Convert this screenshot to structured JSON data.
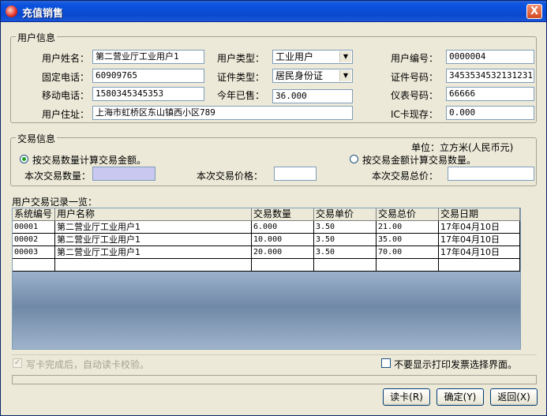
{
  "window": {
    "title": "充值销售",
    "close_label": "X"
  },
  "user_info": {
    "legend": "用户信息",
    "name_label": "用户姓名：",
    "name_value": "第二营业厅工业用户1",
    "type_label": "用户类型：",
    "type_value": "工业用户",
    "number_label": "用户编号：",
    "number_value": "0000004",
    "phone_label": "固定电话：",
    "phone_value": "60909765",
    "id_type_label": "证件类型：",
    "id_type_value": "居民身份证",
    "id_number_label": "证件号码：",
    "id_number_value": "3453534532131231",
    "mobile_label": "移动电话：",
    "mobile_value": "1580345345353",
    "purchased_label": "今年已售：",
    "purchased_value": "36.000",
    "meter_label": "仪表号码：",
    "meter_value": "66666",
    "address_label": "用户住址：",
    "address_value": "上海市虹桥区东山镇西小区789",
    "ic_stock_label": "IC卡现存：",
    "ic_stock_value": "0.000"
  },
  "trade_info": {
    "legend": "交易信息",
    "unit_label": "单位：立方米(人民币元)",
    "radio_by_quantity": "按交易数量计算交易金额。",
    "radio_by_amount": "按交易金额计算交易数量。",
    "quantity_label": "本次交易数量：",
    "quantity_value": "",
    "price_label": "本次交易价格：",
    "price_value": "",
    "total_label": "本次交易总价：",
    "total_value": ""
  },
  "records": {
    "title": "用户交易记录一览：",
    "columns": [
      "系统编号",
      "用户名称",
      "交易数量",
      "交易单价",
      "交易总价",
      "交易日期"
    ],
    "rows": [
      [
        "00001",
        "第二营业厅工业用户1",
        "6.000",
        "3.50",
        "21.00",
        "17年04月10日"
      ],
      [
        "00002",
        "第二营业厅工业用户1",
        "10.000",
        "3.50",
        "35.00",
        "17年04月10日"
      ],
      [
        "00003",
        "第二营业厅工业用户1",
        "20.000",
        "3.50",
        "70.00",
        "17年04月10日"
      ],
      [
        "",
        "",
        "",
        "",
        "",
        ""
      ]
    ]
  },
  "options": {
    "auto_verify_label": "写卡完成后，自动读卡校验。",
    "hide_print_label": "不要显示打印发票选择界面。"
  },
  "buttons": {
    "read_card": "读卡(R)",
    "confirm": "确定(Y)",
    "back": "返回(X)"
  }
}
